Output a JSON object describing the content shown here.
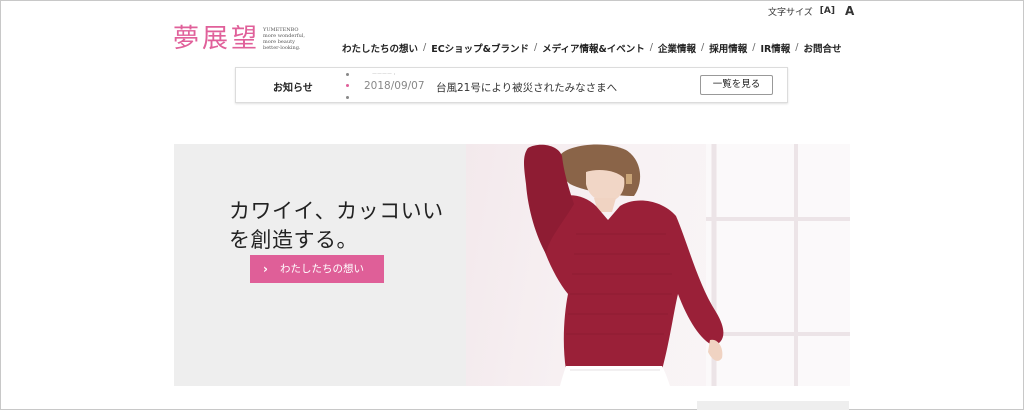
{
  "header": {
    "font_size": {
      "label": "文字サイズ",
      "small": "[A]",
      "large": "A"
    },
    "logo": {
      "text": "夢展望",
      "sub_lines": [
        "YUMETENBO",
        "more wonderful,",
        "more beauty",
        "better-looking."
      ]
    },
    "nav": [
      "わたしたちの想い",
      "ECショップ&ブランド",
      "メディア情報&イベント",
      "企業情報",
      "採用情報",
      "IR情報",
      "お問合せ"
    ],
    "nav_separator": "/"
  },
  "news": {
    "label": "お知らせ",
    "ghost_text": "ーーーー・",
    "date": "2018/09/07",
    "title": "台風21号により被災されたみなさまへ",
    "button": "一覧を見る"
  },
  "hero": {
    "copy_line1": "カワイイ、カッコいい",
    "copy_line2": "を創造する。",
    "button_label": "わたしたちの想い",
    "button_icon": "chevron-right-icon",
    "image": "woman-in-red-sweater-photo"
  },
  "colors": {
    "accent": "#df5f98",
    "logo": "#e0609a",
    "sweater": "#9a2038"
  }
}
